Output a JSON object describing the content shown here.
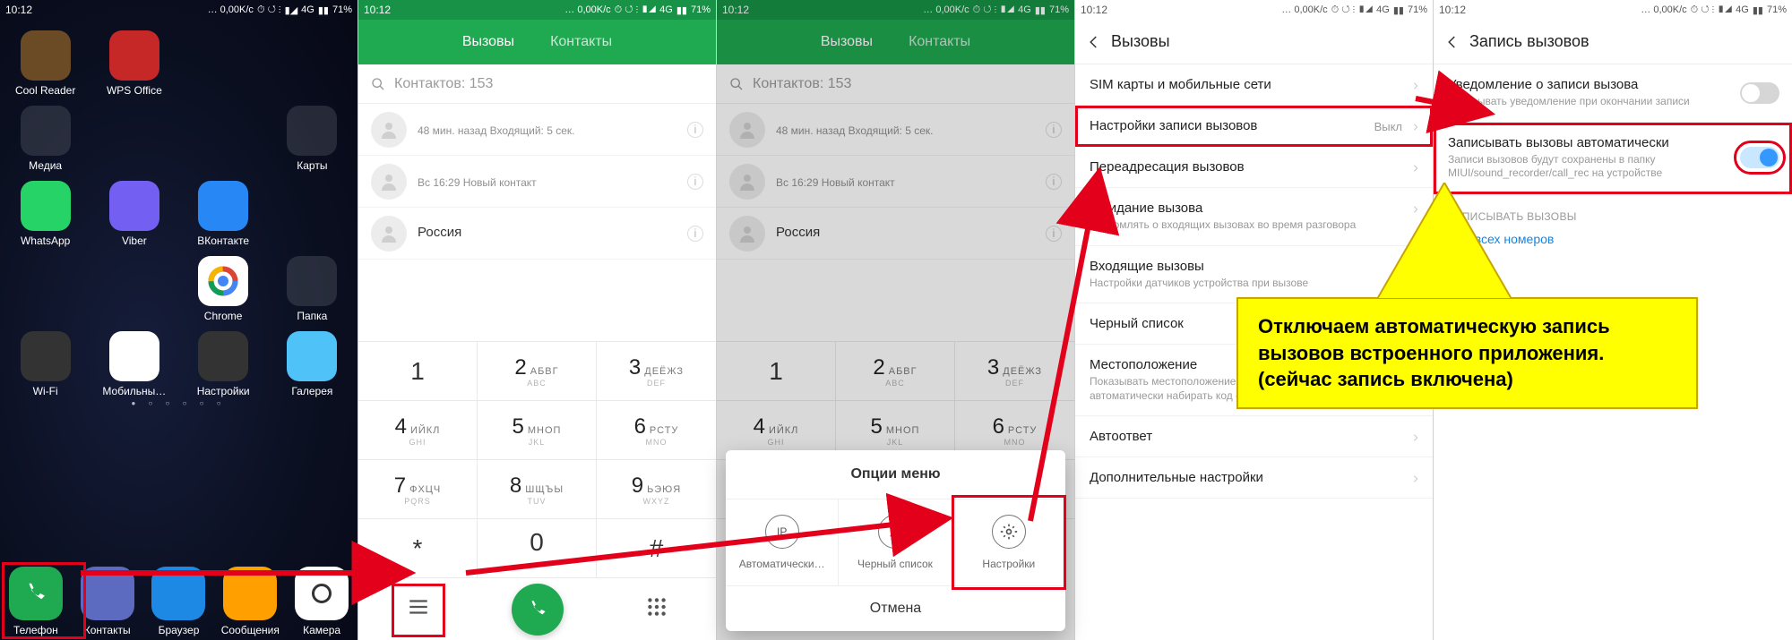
{
  "status": {
    "time": "10:12",
    "net": "…  0,00K/c",
    "signal": "4G",
    "batt_pct": "71%"
  },
  "s1": {
    "apps": [
      {
        "label": "Cool Reader",
        "color": "#6b4a26"
      },
      {
        "label": "WPS Office",
        "color": "#c62828"
      },
      {
        "label": "Медиа",
        "folder": true,
        "dots": [
          "#d32f2f",
          "#1976d2",
          "#388e3c",
          "#fbc02d"
        ]
      },
      {
        "label": "Карты",
        "folder": true,
        "dots": [
          "#1e88e5",
          "#43a047",
          "#e53935",
          "#8e24aa"
        ]
      },
      {
        "label": "WhatsApp",
        "color": "#25d366"
      },
      {
        "label": "Viber",
        "color": "#7360f2"
      },
      {
        "label": "ВКонтакте",
        "color": "#2787f5"
      },
      {
        "label": "Chrome",
        "color": "#ffffff",
        "ring": true
      },
      {
        "label": "Папка",
        "folder": true,
        "dots": [
          "#ffa000",
          "#607d8b",
          "#00897b",
          "#5e35b1"
        ]
      },
      {
        "label": "Wi-Fi",
        "color": "#333333"
      },
      {
        "label": "Мобильны…",
        "color": "#ffffff"
      },
      {
        "label": "Настройки",
        "color": "#333333"
      },
      {
        "label": "Галерея",
        "color": "#4fc3f7"
      }
    ],
    "dock": [
      {
        "label": "Телефон",
        "color": "#1fa951"
      },
      {
        "label": "Контакты",
        "color": "#5c6bc0"
      },
      {
        "label": "Браузер",
        "color": "#1e88e5"
      },
      {
        "label": "Сообщения",
        "color": "#ffa000"
      },
      {
        "label": "Камера",
        "color": "#ffffff"
      }
    ]
  },
  "s2": {
    "tab_calls": "Вызовы",
    "tab_contacts": "Контакты",
    "search_placeholder": "Контактов: 153",
    "list": [
      {
        "line1": "",
        "line2": "48 мин. назад Входящий: 5 сек."
      },
      {
        "line1": "",
        "line2": "Вс 16:29 Новый контакт"
      },
      {
        "line1": "Россия",
        "line2": ""
      }
    ],
    "keys": [
      {
        "num": "1",
        "ru": "",
        "en": ""
      },
      {
        "num": "2",
        "ru": "АБВГ",
        "en": "ABC"
      },
      {
        "num": "3",
        "ru": "ДЕЁЖЗ",
        "en": "DEF"
      },
      {
        "num": "4",
        "ru": "ИЙКЛ",
        "en": "GHI"
      },
      {
        "num": "5",
        "ru": "МНОП",
        "en": "JKL"
      },
      {
        "num": "6",
        "ru": "РСТУ",
        "en": "MNO"
      },
      {
        "num": "7",
        "ru": "ФХЦЧ",
        "en": "PQRS"
      },
      {
        "num": "8",
        "ru": "ШЩЪЫ",
        "en": "TUV"
      },
      {
        "num": "9",
        "ru": "ЬЭЮЯ",
        "en": "WXYZ"
      },
      {
        "num": "*",
        "ru": "",
        "en": ""
      },
      {
        "num": "0",
        "ru": "",
        "en": "+"
      },
      {
        "num": "#",
        "ru": "",
        "en": ""
      }
    ]
  },
  "s3": {
    "menu_title": "Опции меню",
    "opt_auto": "Автоматически…",
    "opt_black": "Черный список",
    "opt_settings": "Настройки",
    "cancel": "Отмена"
  },
  "s4": {
    "title": "Вызовы",
    "items": [
      {
        "t": "SIM карты и мобильные сети"
      },
      {
        "t": "Настройки записи вызовов",
        "val": "Выкл",
        "hl": true
      },
      {
        "t": "Переадресация вызовов"
      },
      {
        "t": "Ожидание вызова",
        "d": "Уведомлять о входящих вызовах во время разговора"
      },
      {
        "t": "Входящие вызовы",
        "d": "Настройки датчиков устройства при вызове"
      },
      {
        "t": "Черный список"
      },
      {
        "t": "Местоположение",
        "d": "Показывать местоположение номера и автоматически набирать код страны"
      },
      {
        "t": "Автоответ"
      },
      {
        "t": "Дополнительные настройки"
      }
    ]
  },
  "s5": {
    "title": "Запись вызовов",
    "row1_t": "Уведомление о записи вызова",
    "row1_d": "Показывать уведомление при окончании записи",
    "row2_t": "Записывать вызовы автоматически",
    "row2_d": "Записи вызовов будут сохранены в папку MIUI/sound_recorder/call_rec на устройстве",
    "sect": "ЗАПИСЫВАТЬ ВЫЗОВЫ",
    "link": "От всех номеров"
  },
  "callout": "Отключаем автоматическую запись вызовов встроенного приложения.\n(сейчас запись включена)"
}
